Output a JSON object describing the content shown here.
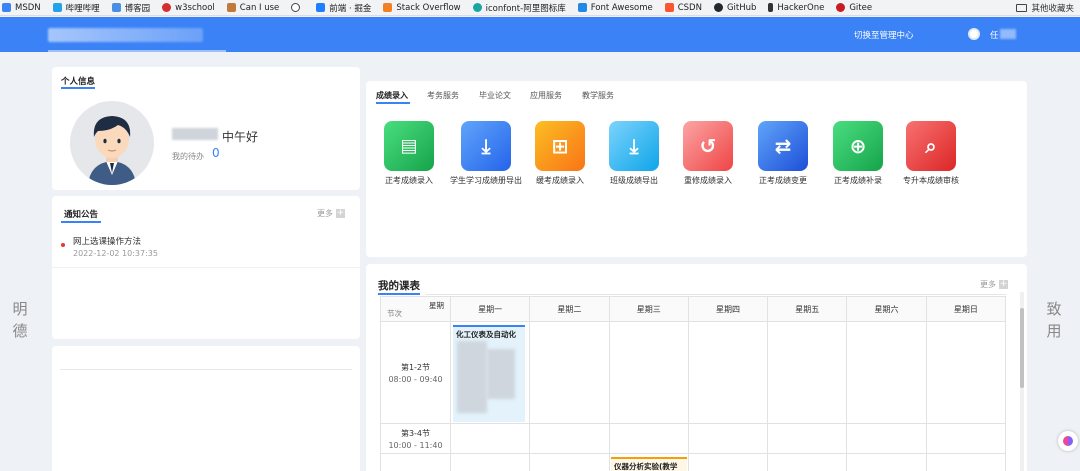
{
  "bookmarks": [
    {
      "label": "MSDN",
      "color": "#3b82f6"
    },
    {
      "label": "哔哩哔哩",
      "color": "#22a2e8"
    },
    {
      "label": "博客园",
      "color": "#4a90e2"
    },
    {
      "label": "w3school",
      "color": "#d62d2d"
    },
    {
      "label": "Can I use",
      "color": "#c2793a"
    },
    {
      "label": "",
      "color": "#444444"
    },
    {
      "label": "前端 · 掘金",
      "color": "#1e80ff"
    },
    {
      "label": "Stack Overflow",
      "color": "#f48024"
    },
    {
      "label": "iconfont-阿里图标库",
      "color": "#1aa5a0"
    },
    {
      "label": "Font Awesome",
      "color": "#228ae6"
    },
    {
      "label": "CSDN",
      "color": "#fc5531"
    },
    {
      "label": "GitHub",
      "color": "#24292e"
    },
    {
      "label": "HackerOne",
      "color": "#333333"
    },
    {
      "label": "Gitee",
      "color": "#c71d23"
    }
  ],
  "bookmarks_other": "其他收藏夹",
  "header": {
    "switch_admin": "切换至管理中心",
    "user_name_prefix": "任"
  },
  "side_text": {
    "left": [
      "明",
      "德"
    ],
    "right": [
      "致",
      "用"
    ]
  },
  "profile": {
    "title": "个人信息",
    "greeting": "中午好",
    "todo_label": "我的待办",
    "todo_count": "0"
  },
  "notice": {
    "title": "通知公告",
    "more": "更多",
    "items": [
      {
        "title": "网上选课操作方法",
        "time": "2022-12-02 10:37:35"
      }
    ]
  },
  "services": {
    "tabs": [
      "成绩录入",
      "考务服务",
      "毕业论文",
      "应用服务",
      "教学服务"
    ],
    "items": [
      {
        "label": "正考成绩录入",
        "icon": "doc-icon",
        "color": "#22c55e"
      },
      {
        "label": "学生学习成绩册导出",
        "icon": "download-icon",
        "color": "#3b82f6"
      },
      {
        "label": "缓考成绩录入",
        "icon": "plus-doc-icon",
        "color": "#f59e0b"
      },
      {
        "label": "班级成绩导出",
        "icon": "download-icon",
        "color": "#38bdf8"
      },
      {
        "label": "重修成绩录入",
        "icon": "redo-icon",
        "color": "#f87171"
      },
      {
        "label": "正考成绩变更",
        "icon": "swap-icon",
        "color": "#3b82f6"
      },
      {
        "label": "正考成绩补录",
        "icon": "add-icon",
        "color": "#22c55e"
      },
      {
        "label": "专升本成绩审核",
        "icon": "review-icon",
        "color": "#ef4444"
      }
    ]
  },
  "schedule": {
    "title": "我的课表",
    "more": "更多",
    "corner_top": "星期",
    "corner_bottom": "节次",
    "days": [
      "星期一",
      "星期二",
      "星期三",
      "星期四",
      "星期五",
      "星期六",
      "星期日"
    ],
    "periods": [
      {
        "name": "第1-2节",
        "time": "08:00 - 09:40"
      },
      {
        "name": "第3-4节",
        "time": "10:00 - 11:40"
      },
      {
        "name": "",
        "time": ""
      }
    ],
    "courses": [
      {
        "text": "化工仪表及自动化"
      },
      {
        "text": "仪器分析实验(教学"
      }
    ]
  }
}
